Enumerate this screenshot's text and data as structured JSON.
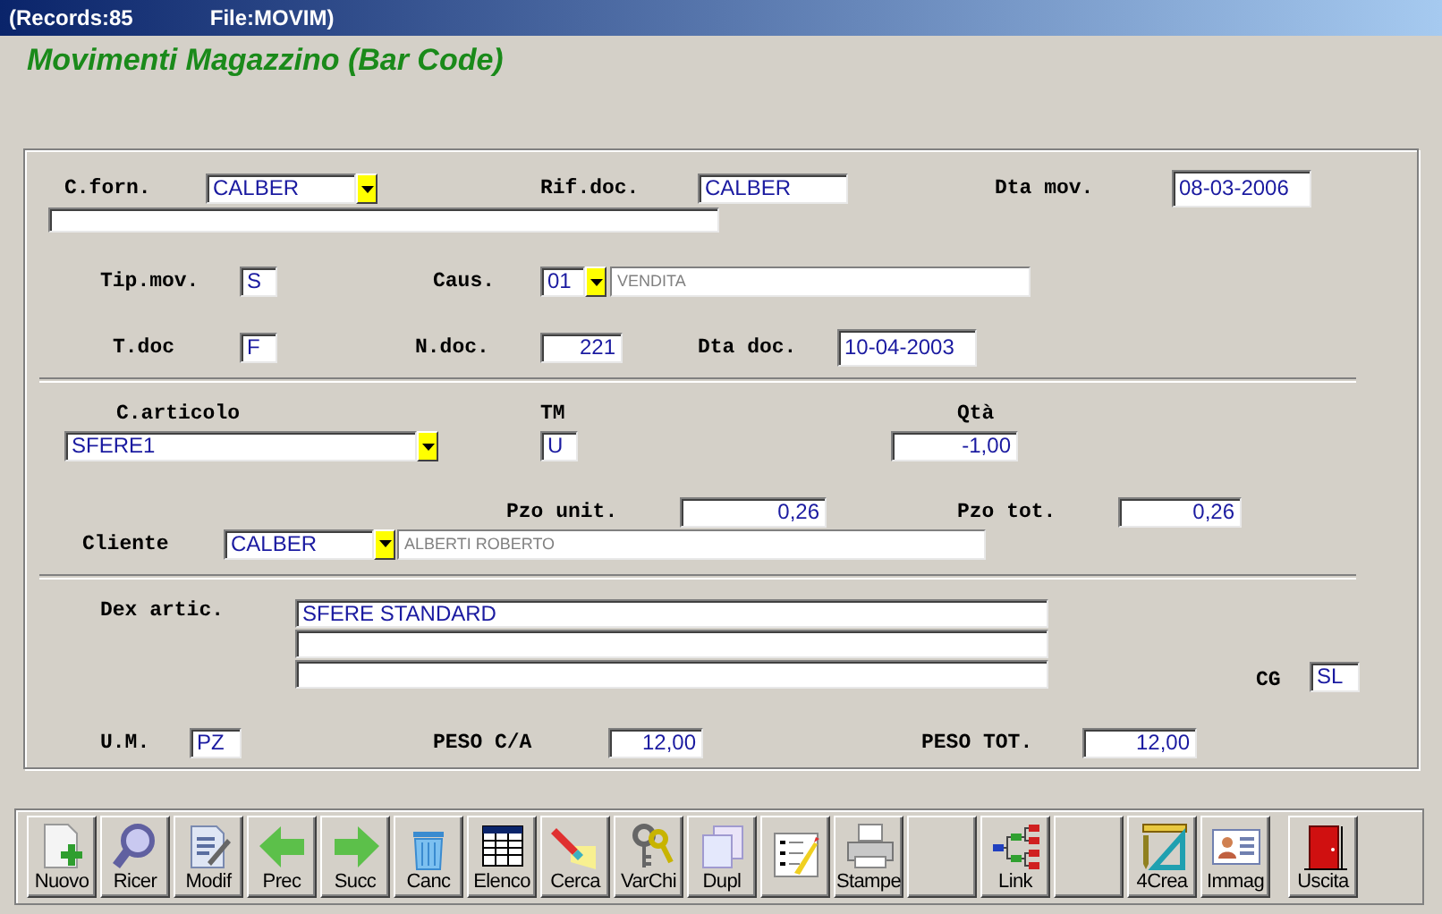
{
  "window": {
    "title_parts": [
      "(Records:85",
      "File:MOVIM)"
    ]
  },
  "heading": "Movimenti Magazzino (Bar Code)",
  "form": {
    "rows": [
      {
        "kind": "fields",
        "items": [
          {
            "kind": "label",
            "text": "C.forn."
          },
          {
            "kind": "combo",
            "value": "CALBER"
          },
          {
            "kind": "label",
            "text": "Rif.doc."
          },
          {
            "kind": "field",
            "value": "CALBER"
          },
          {
            "kind": "label",
            "text": "Dta mov."
          },
          {
            "kind": "field",
            "value": "08-03-2006"
          }
        ]
      },
      {
        "kind": "fields",
        "items": [
          {
            "kind": "field"
          }
        ]
      },
      {
        "kind": "fields",
        "items": [
          {
            "kind": "label",
            "text": "Tip.mov."
          },
          {
            "kind": "field",
            "value": "S"
          },
          {
            "kind": "label",
            "text": "Caus."
          },
          {
            "kind": "combo",
            "value": "01"
          },
          {
            "kind": "desc",
            "value": "VENDITA"
          }
        ]
      },
      {
        "kind": "fields",
        "items": [
          {
            "kind": "label",
            "text": "T.doc"
          },
          {
            "kind": "field",
            "value": "F"
          },
          {
            "kind": "label",
            "text": "N.doc."
          },
          {
            "kind": "field",
            "value": "221"
          },
          {
            "kind": "label",
            "text": "Dta doc."
          },
          {
            "kind": "field",
            "value": "10-04-2003"
          }
        ]
      },
      {
        "kind": "divider"
      },
      {
        "kind": "fields",
        "items": [
          {
            "kind": "label",
            "text": "C.articolo"
          },
          {
            "kind": "label",
            "text": "TM"
          },
          {
            "kind": "label",
            "text": "Qtà"
          }
        ]
      },
      {
        "kind": "fields",
        "items": [
          {
            "kind": "combo",
            "value": "SFERE1"
          },
          {
            "kind": "field",
            "value": "U"
          },
          {
            "kind": "field",
            "value": "-1,00"
          }
        ]
      },
      {
        "kind": "fields",
        "items": [
          {
            "kind": "label",
            "text": "Pzo unit."
          },
          {
            "kind": "field",
            "value": "0,26"
          },
          {
            "kind": "label",
            "text": "Pzo tot."
          },
          {
            "kind": "field",
            "value": "0,26"
          }
        ]
      },
      {
        "kind": "fields",
        "items": [
          {
            "kind": "label",
            "text": "Cliente"
          },
          {
            "kind": "combo",
            "value": "CALBER"
          },
          {
            "kind": "desc",
            "value": "ALBERTI ROBERTO"
          }
        ]
      },
      {
        "kind": "divider"
      },
      {
        "kind": "fields",
        "items": [
          {
            "kind": "label",
            "text": "Dex artic."
          },
          {
            "kind": "stack",
            "fields": [
              {
                "kind": "field",
                "value": "SFERE STANDARD"
              },
              {
                "kind": "field"
              },
              {
                "kind": "field"
              }
            ]
          },
          {
            "kind": "label",
            "text": "CG"
          },
          {
            "kind": "field",
            "value": "SL"
          }
        ]
      },
      {
        "kind": "fields",
        "items": [
          {
            "kind": "label",
            "text": "U.M."
          },
          {
            "kind": "field",
            "value": "PZ"
          },
          {
            "kind": "label",
            "text": "PESO C/A"
          },
          {
            "kind": "field",
            "value": "12,00"
          },
          {
            "kind": "label",
            "text": "PESO TOT."
          },
          {
            "kind": "field",
            "value": "12,00"
          }
        ]
      }
    ]
  },
  "toolbar": {
    "buttons": [
      {
        "kind": "labeled",
        "label": "Nuovo"
      },
      {
        "kind": "labeled",
        "label": "Ricer"
      },
      {
        "kind": "labeled",
        "label": "Modif"
      },
      {
        "kind": "labeled",
        "label": "Prec"
      },
      {
        "kind": "labeled",
        "label": "Succ"
      },
      {
        "kind": "labeled",
        "label": "Canc"
      },
      {
        "kind": "labeled",
        "label": "Elenco"
      },
      {
        "kind": "labeled",
        "label": "Cerca"
      },
      {
        "kind": "labeled",
        "label": "VarChi"
      },
      {
        "kind": "labeled",
        "label": "Dupl"
      },
      {
        "kind": "icon"
      },
      {
        "kind": "labeled",
        "label": "Stampe"
      },
      {
        "kind": "blank"
      },
      {
        "kind": "labeled",
        "label": "Link"
      },
      {
        "kind": "blank"
      },
      {
        "kind": "labeled",
        "label": "4Crea"
      },
      {
        "kind": "labeled",
        "label": "Immag"
      },
      {
        "kind": "labeled",
        "label": "Uscita"
      }
    ]
  }
}
